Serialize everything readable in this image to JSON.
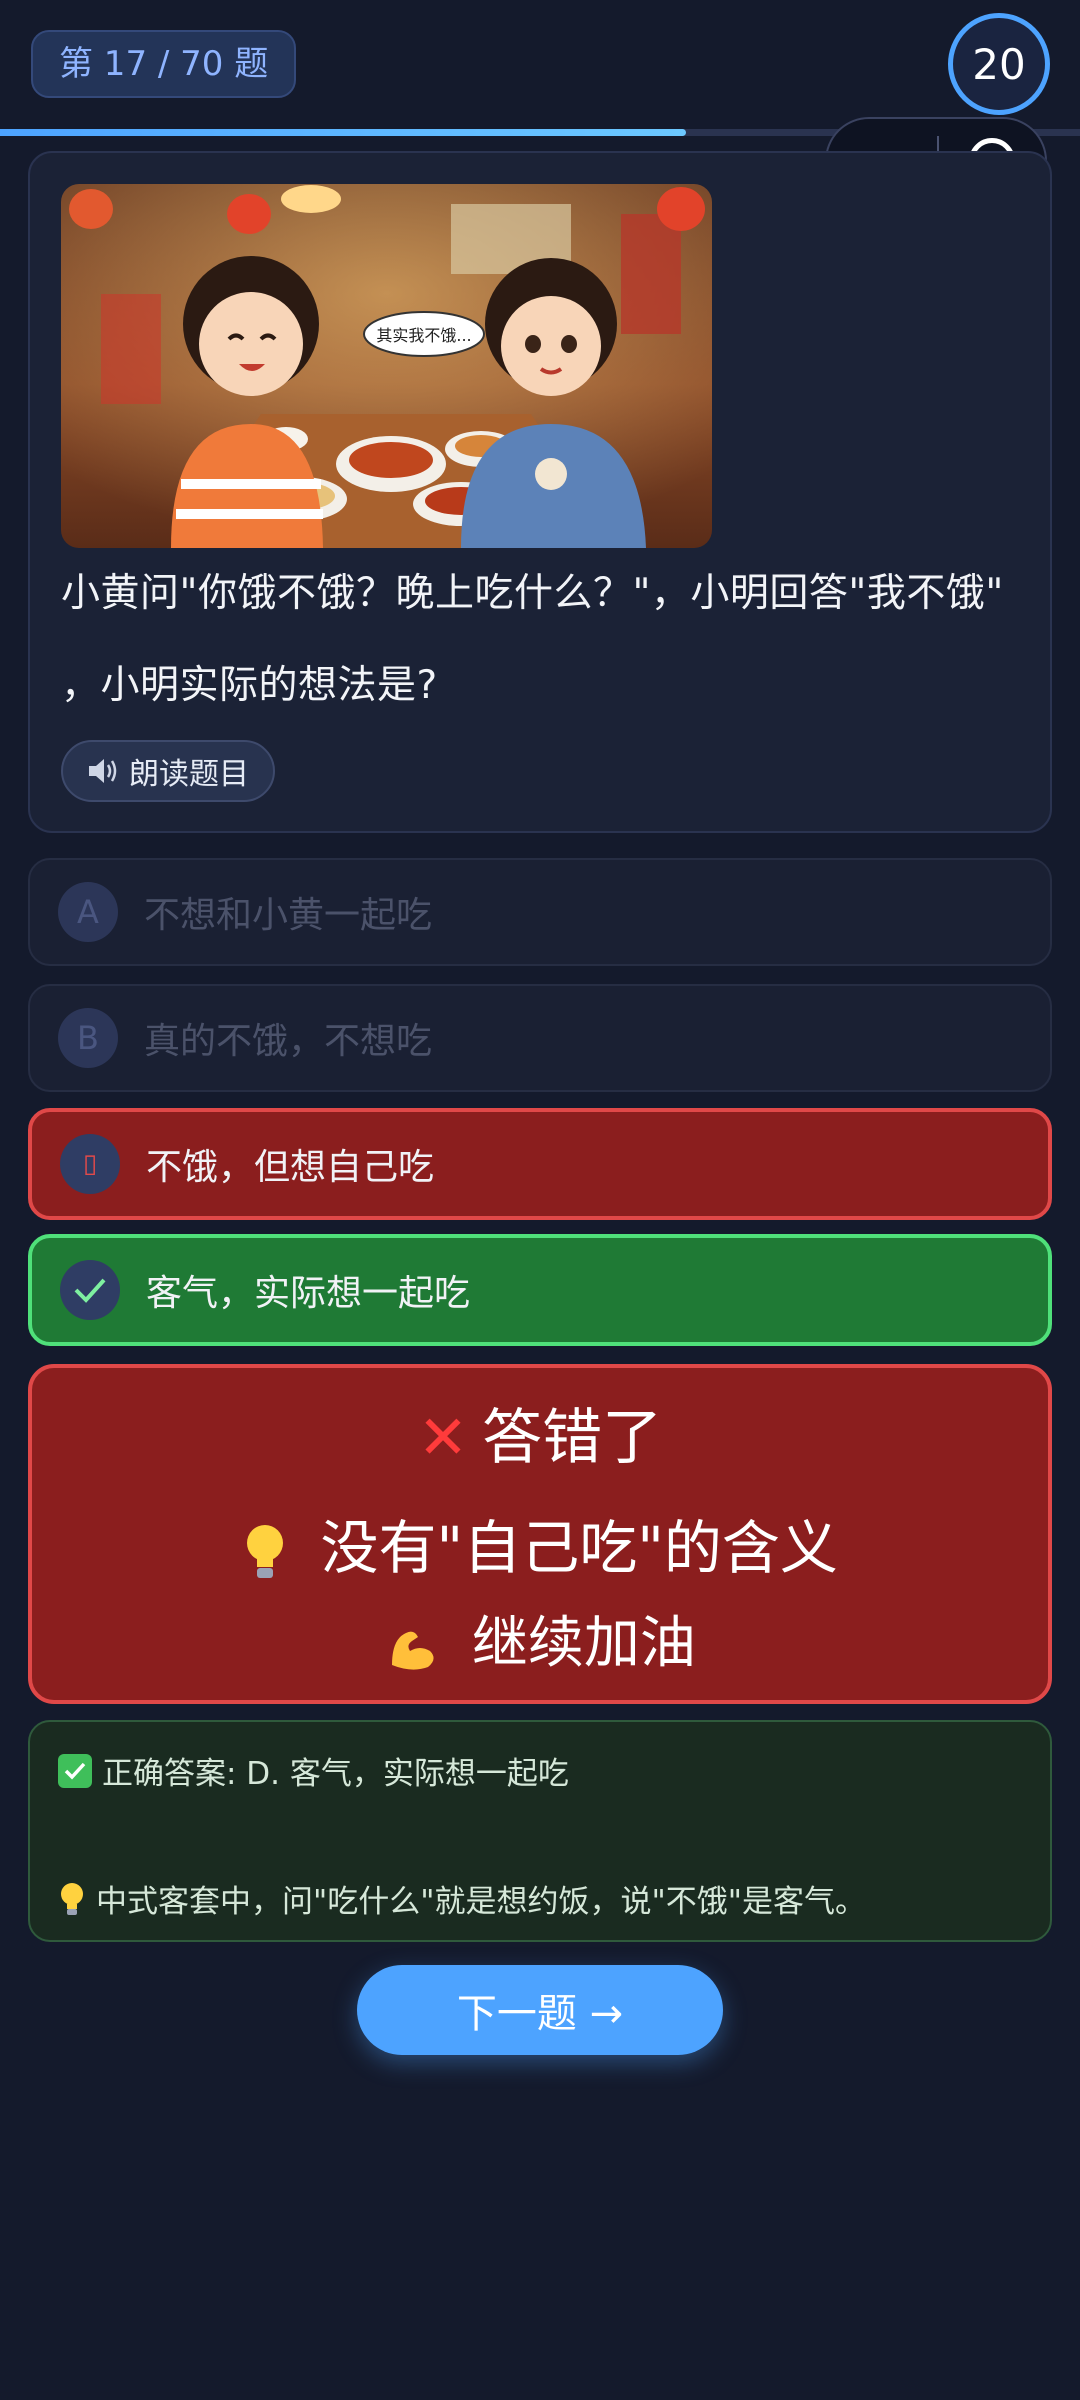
{
  "header": {
    "question_counter": "第 17 / 70 题",
    "timer": "20",
    "progress": 0.635
  },
  "capsule": {
    "more_icon": "more-dots-icon",
    "close_icon": "target-circle-icon"
  },
  "question": {
    "image_bubble_text": "其实我不饿...",
    "text_line1": "小黄问\"你饿不饿？晚上吃什么？\"，小明回答\"我不饿\"",
    "text_line2": "，小明实际的想法是?",
    "read_button": "朗读题目",
    "read_icon": "speaker-icon"
  },
  "options": [
    {
      "letter": "A",
      "label": "不想和小黄一起吃",
      "state": "disabled"
    },
    {
      "letter": "B",
      "label": "真的不饿，不想吃",
      "state": "disabled"
    },
    {
      "letter": "",
      "label": "不饿，但想自己吃",
      "state": "wrong"
    },
    {
      "letter": "✓",
      "label": "客气，实际想一起吃",
      "state": "correct"
    }
  ],
  "feedback": {
    "title": "答错了",
    "reason": "没有\"自己吃\"的含义",
    "encourage": "继续加油"
  },
  "answer": {
    "correct_answer": "正确答案: D. 客气，实际想一起吃",
    "explanation": "中式客套中，问\"吃什么\"就是想约饭，说\"不饿\"是客气。"
  },
  "next_button": "下一题 →",
  "colors": {
    "background": "#141a2c",
    "accent": "#4da3ff",
    "wrong": "#8b1e1e",
    "correct": "#1f7a35"
  }
}
